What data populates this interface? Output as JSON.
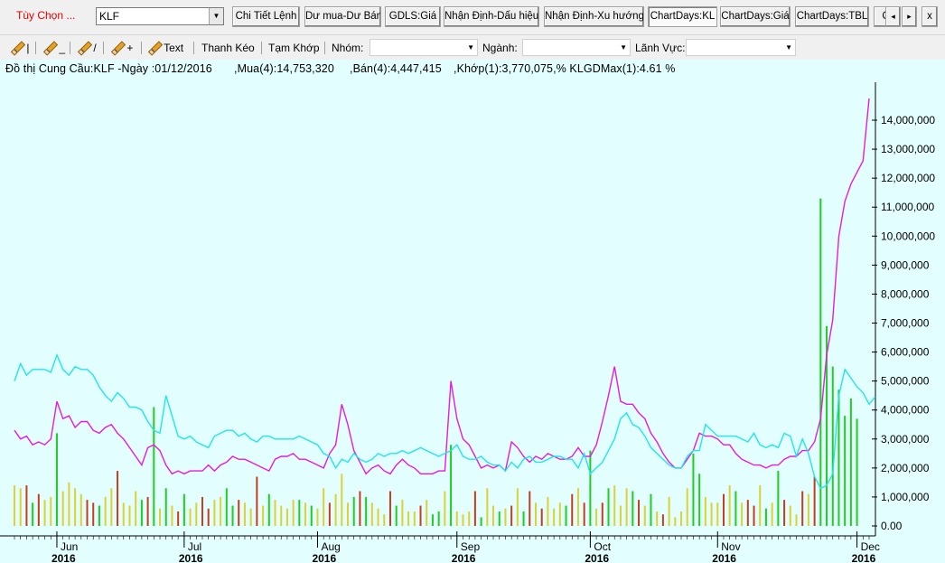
{
  "toolbar": {
    "options_label": "Tùy Chọn ...",
    "symbol_value": "KLF",
    "buttons": [
      "Chi Tiết Lệnh",
      "Dư mua-Dư Bán",
      "GDLS:Giá",
      "Nhận Định-Dấu hiệu",
      "Nhận Định-Xu hướng",
      "ChartDays:KL",
      "ChartDays:Giá",
      "ChartDays:TBL",
      "C"
    ],
    "active_button": "ChartDays:KL",
    "nav_prev": "◂",
    "nav_next": "▸",
    "close": "x"
  },
  "tools": {
    "pencil_1": "|",
    "pencil_2": "_",
    "pencil_3": "/",
    "pencil_4": "+",
    "text_tool": "Text",
    "drag_tool": "Thanh Kéo",
    "pause_tool": "Tạm Khớp",
    "group_label": "Nhóm:",
    "industry_label": "Ngành:",
    "sector_label": "Lãnh Vực:"
  },
  "colors": {
    "buy": "#e619e6",
    "sell": "#22e6e6",
    "match": "#22cc22",
    "bar_up": "#22cc22",
    "bar_down": "#c83c1e",
    "bar_neutral": "#dcd232",
    "background": "#e2fefe"
  },
  "chart_data": {
    "type": "line",
    "title": "Đồ thị Cung Cầu:KLF -Ngày :01/12/2016",
    "legend": {
      "buy": ",Mua(4):14,753,320",
      "sell": ",Bán(4):4,447,415",
      "match": ",Khớp(1):3,770,075,% KLGDMax(1):4.61 %"
    },
    "ylim": [
      0,
      15000000
    ],
    "y_ticks": [
      "0.00",
      "1,000,000",
      "2,000,000",
      "3,000,000",
      "4,000,000",
      "5,000,000",
      "6,000,000",
      "7,000,000",
      "8,000,000",
      "9,000,000",
      "10,000,000",
      "11,000,000",
      "12,000,000",
      "13,000,000",
      "14,000,000"
    ],
    "month_labels": [
      {
        "month": "Jun",
        "year": "2016",
        "index": 7
      },
      {
        "month": "Jul",
        "year": "2016",
        "index": 28
      },
      {
        "month": "Aug",
        "year": "2016",
        "index": 50
      },
      {
        "month": "Sep",
        "year": "2016",
        "index": 73
      },
      {
        "month": "Oct",
        "year": "2016",
        "index": 95
      },
      {
        "month": "Nov",
        "year": "2016",
        "index": 116
      },
      {
        "month": "Dec",
        "year": "2016",
        "index": 139
      }
    ],
    "series": [
      {
        "name": "Mua(4)",
        "values": [
          3300000,
          3000000,
          3100000,
          2800000,
          2900000,
          2800000,
          3000000,
          4300000,
          3700000,
          3800000,
          3400000,
          3600000,
          3600000,
          3300000,
          3200000,
          3400000,
          3500000,
          3200000,
          3000000,
          2700000,
          2400000,
          2100000,
          2700000,
          2800000,
          2600000,
          2100000,
          1800000,
          1900000,
          1800000,
          1900000,
          1900000,
          1900000,
          2100000,
          1900000,
          2100000,
          2200000,
          2400000,
          2300000,
          2300000,
          2200000,
          2100000,
          2000000,
          1900000,
          2300000,
          2400000,
          2400000,
          2500000,
          2300000,
          2300000,
          2200000,
          2100000,
          2000000,
          2500000,
          2800000,
          4200000,
          3500000,
          2600000,
          2200000,
          1800000,
          2000000,
          2100000,
          1900000,
          1800000,
          2100000,
          2300000,
          2100000,
          2000000,
          1800000,
          1800000,
          1800000,
          1900000,
          1900000,
          5000000,
          3700000,
          3000000,
          2800000,
          2400000,
          2000000,
          2100000,
          2000000,
          2100000,
          1900000,
          2900000,
          2700000,
          2400000,
          2200000,
          2400000,
          2300000,
          2500000,
          2400000,
          2300000,
          2300000,
          2400000,
          2700000,
          2400000,
          2400000,
          2800000,
          3600000,
          4500000,
          5500000,
          4300000,
          4200000,
          4200000,
          3900000,
          3700000,
          3200000,
          2900000,
          2500000,
          2200000,
          2000000,
          2000000,
          2300000,
          2600000,
          3200000,
          3100000,
          3100000,
          3000000,
          2800000,
          2800000,
          2500000,
          2300000,
          2200000,
          2100000,
          2100000,
          2000000,
          2100000,
          2100000,
          2300000,
          2400000,
          2400000,
          2600000,
          2600000,
          2900000,
          3700000,
          5900000,
          7100000,
          10000000,
          11200000,
          11800000,
          12200000,
          12600000,
          14750000
        ]
      },
      {
        "name": "Bán(4)",
        "values": [
          5000000,
          5600000,
          5200000,
          5400000,
          5400000,
          5400000,
          5300000,
          5900000,
          5400000,
          5200000,
          5500000,
          5400000,
          5400000,
          5200000,
          4800000,
          4500000,
          4300000,
          4600000,
          4400000,
          4100000,
          4100000,
          4000000,
          3600000,
          3300000,
          3200000,
          4500000,
          3800000,
          3100000,
          3000000,
          3100000,
          2900000,
          2800000,
          2700000,
          3100000,
          3200000,
          3300000,
          3300000,
          3100000,
          3200000,
          3000000,
          2900000,
          3100000,
          3100000,
          3000000,
          3000000,
          3000000,
          3000000,
          3100000,
          3000000,
          2900000,
          2800000,
          2500000,
          2400000,
          2000000,
          2300000,
          2200000,
          2500000,
          2300000,
          2200000,
          2300000,
          2500000,
          2400000,
          2500000,
          2500000,
          2600000,
          2500000,
          2600000,
          2700000,
          2600000,
          2500000,
          2400000,
          2500000,
          2600000,
          2800000,
          2400000,
          2300000,
          2300000,
          2400000,
          2200000,
          2100000,
          2100000,
          1900000,
          2200000,
          2000000,
          2300000,
          2400000,
          2200000,
          2200000,
          2300000,
          2400000,
          2400000,
          2300000,
          2300000,
          2000000,
          2500000,
          1800000,
          2000000,
          2200000,
          2600000,
          3000000,
          3700000,
          3900000,
          3500000,
          3400000,
          3100000,
          2700000,
          2500000,
          2300000,
          2100000,
          2000000,
          2000000,
          2400000,
          2600000,
          2600000,
          3500000,
          3300000,
          3100000,
          3100000,
          3100000,
          3100000,
          3000000,
          2900000,
          3200000,
          2800000,
          2700000,
          2800000,
          2700000,
          3200000,
          3100000,
          2400000,
          3000000,
          2500000,
          1700000,
          1300000,
          1400000,
          1800000,
          4500000,
          5400000,
          5100000,
          4800000,
          4600000,
          4200000,
          4450000
        ]
      },
      {
        "name": "Khớp(1)",
        "values": [
          1400000,
          1300000,
          1400000,
          800000,
          1100000,
          900000,
          1000000,
          3200000,
          1200000,
          1500000,
          1300000,
          1100000,
          900000,
          800000,
          700000,
          1000000,
          1300000,
          1900000,
          800000,
          700000,
          1200000,
          900000,
          1000000,
          4100000,
          600000,
          1300000,
          700000,
          500000,
          1100000,
          600000,
          800000,
          1000000,
          600000,
          900000,
          1000000,
          1300000,
          700000,
          900000,
          800000,
          600000,
          1700000,
          700000,
          1100000,
          900000,
          700000,
          600000,
          900000,
          900000,
          800000,
          700000,
          600000,
          1300000,
          800000,
          1100000,
          1800000,
          800000,
          1000000,
          1200000,
          1000000,
          800000,
          600000,
          400000,
          1200000,
          700000,
          900000,
          500000,
          500000,
          700000,
          900000,
          400000,
          500000,
          1200000,
          2800000,
          500000,
          400000,
          500000,
          1200000,
          300000,
          1300000,
          700000,
          500000,
          600000,
          700000,
          1300000,
          500000,
          1200000,
          800000,
          600000,
          1000000,
          600000,
          800000,
          700000,
          1100000,
          1300000,
          800000,
          2600000,
          600000,
          800000,
          1300000,
          1400000,
          700000,
          1300000,
          1200000,
          900000,
          700000,
          1100000,
          500000,
          400000,
          1000000,
          300000,
          500000,
          1300000,
          2500000,
          1800000,
          1000000,
          800000,
          800000,
          1100000,
          1400000,
          1200000,
          800000,
          900000,
          700000,
          1400000,
          600000,
          800000,
          1900000,
          900000,
          700000,
          400000,
          1200000,
          1100000,
          1700000,
          11300000,
          6900000,
          5500000,
          4700000,
          3800000,
          4400000,
          3700000
        ]
      }
    ]
  }
}
